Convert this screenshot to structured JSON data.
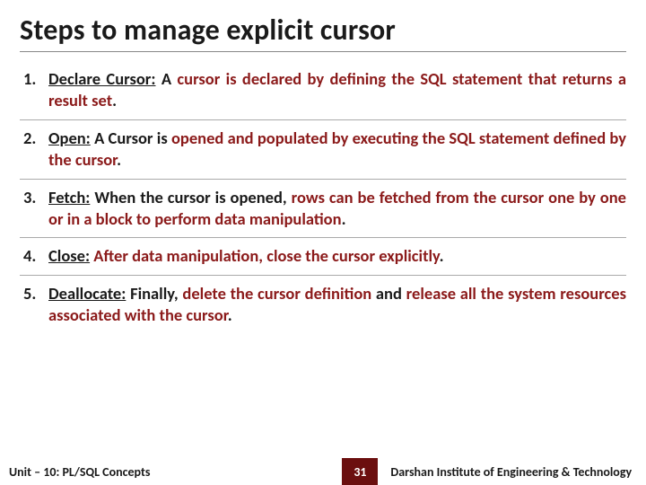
{
  "title": "Steps to manage explicit cursor",
  "items": [
    {
      "lead": "Declare Cursor:",
      "rest_pre": " A ",
      "emph": "cursor is declared by defining the SQL statement that returns a result set",
      "rest_post": "."
    },
    {
      "lead": "Open:",
      "rest_pre": " A Cursor is ",
      "emph": "opened and populated by executing the SQL statement defined by the cursor",
      "rest_post": "."
    },
    {
      "lead": "Fetch:",
      "rest_pre": " When the cursor is opened, ",
      "emph": "rows can be fetched from the cursor one by one or in a block to perform data manipulation",
      "rest_post": "."
    },
    {
      "lead": "Close:",
      "rest_pre": " ",
      "emph": "After data manipulation, close the cursor explicitly",
      "rest_post": "."
    },
    {
      "lead": "Deallocate:",
      "rest_pre": " Finally, ",
      "emph": "delete the cursor definition",
      "rest_post_mid": " and ",
      "emph2": "release all the system resources associated with the cursor",
      "rest_post": "."
    }
  ],
  "footer": {
    "unit": "Unit – 10: PL/SQL Concepts",
    "page": "31",
    "org": "Darshan Institute of Engineering & Technology"
  }
}
